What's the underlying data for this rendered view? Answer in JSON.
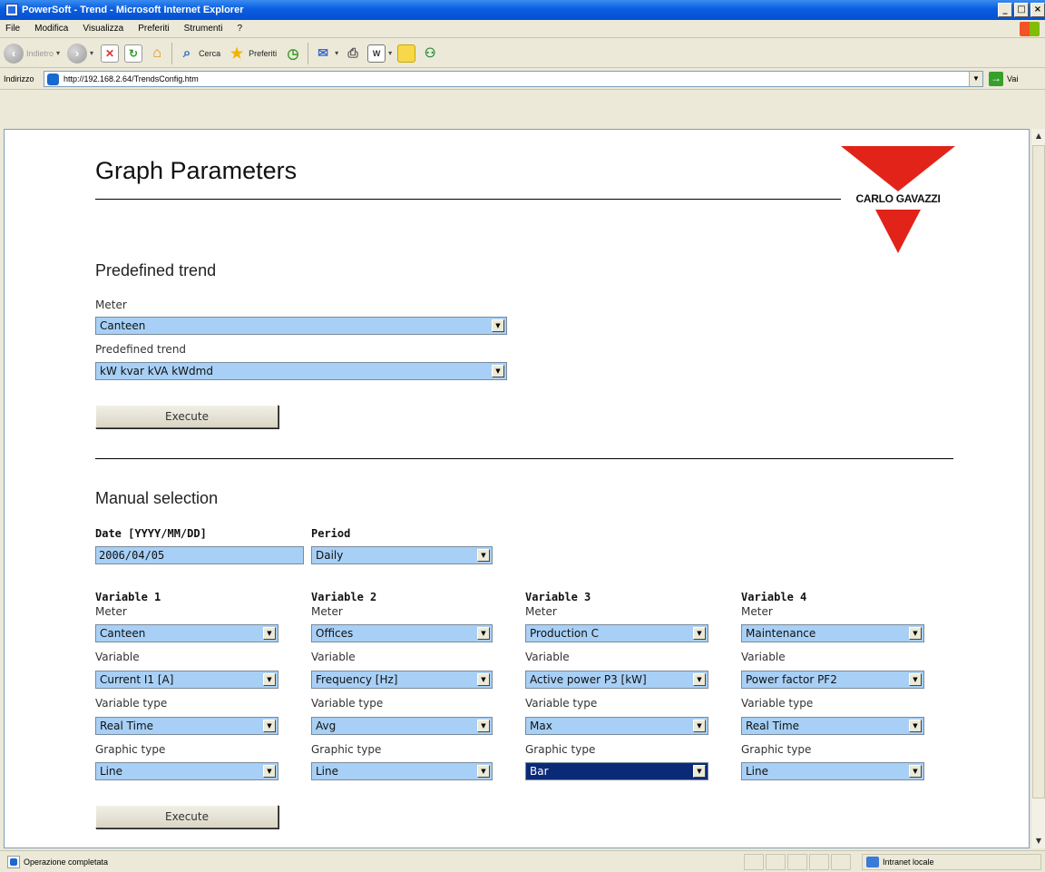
{
  "window": {
    "title": "PowerSoft - Trend - Microsoft Internet Explorer",
    "controls": [
      "_",
      "□",
      "×"
    ]
  },
  "menu": [
    "File",
    "Modifica",
    "Visualizza",
    "Preferiti",
    "Strumenti",
    "?"
  ],
  "toolbar": {
    "back": "Indietro",
    "search": "Cerca",
    "favorites": "Preferiti"
  },
  "address": {
    "label": "Indirizzo",
    "url": "http://192.168.2.64/TrendsConfig.htm",
    "go": "Vai"
  },
  "page": {
    "title": "Graph Parameters",
    "logo_text": "CARLO GAVAZZI",
    "logo_color": "#e2231a"
  },
  "predefined": {
    "section_title": "Predefined trend",
    "meter_label": "Meter",
    "meter_value": "Canteen",
    "trend_label": "Predefined trend",
    "trend_value": "kW kvar kVA kWdmd",
    "execute": "Execute"
  },
  "manual": {
    "section_title": "Manual selection",
    "date_label": "Date [YYYY/MM/DD]",
    "date_value": "2006/04/05",
    "period_label": "Period",
    "period_value": "Daily",
    "field_labels": {
      "meter": "Meter",
      "variable": "Variable",
      "variable_type": "Variable type",
      "graphic_type": "Graphic type"
    },
    "variables": [
      {
        "title": "Variable 1",
        "meter": "Canteen",
        "variable": "Current I1 [A]",
        "variable_type": "Real Time",
        "graphic_type": "Line"
      },
      {
        "title": "Variable 2",
        "meter": "Offices",
        "variable": "Frequency [Hz]",
        "variable_type": "Avg",
        "graphic_type": "Line"
      },
      {
        "title": "Variable 3",
        "meter": "Production C",
        "variable": "Active power P3 [kW]",
        "variable_type": "Max",
        "graphic_type": "Bar"
      },
      {
        "title": "Variable 4",
        "meter": "Maintenance",
        "variable": "Power factor PF2",
        "variable_type": "Real Time",
        "graphic_type": "Line"
      }
    ],
    "execute": "Execute"
  },
  "status": {
    "text": "Operazione completata",
    "zone": "Intranet locale"
  }
}
